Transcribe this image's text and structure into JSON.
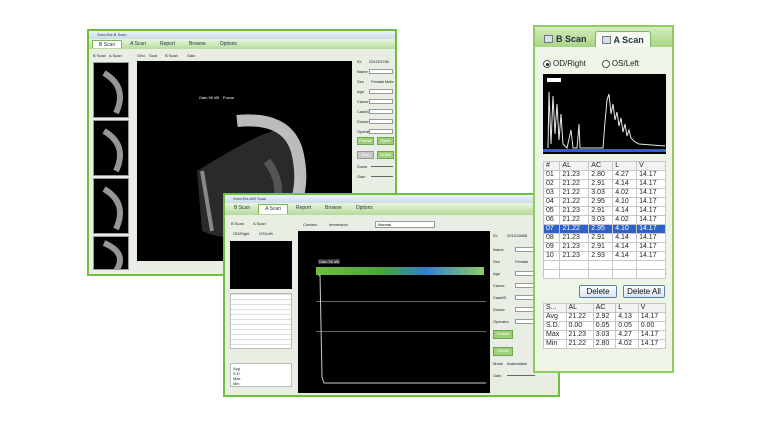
{
  "back_window": {
    "title": "SonoTek B Scan",
    "tabs": [
      "B Scan",
      "A Scan",
      "Report",
      "Browse",
      "Options"
    ],
    "subtabs": [
      "B Scan",
      "A Scan"
    ],
    "toolbar": [
      "Grid",
      "Scal",
      "B Scan",
      "Gain"
    ],
    "overlay_left": "Gain 90 dB",
    "overlay_right": "Focus",
    "id_label": "ID:",
    "id_value": "291203780",
    "form_labels": [
      "Name",
      "Sex",
      "Age",
      "Cause",
      "CaseID",
      "Doctor",
      "Operator"
    ],
    "sex_options": [
      "Female",
      "Male"
    ],
    "buttons": [
      "Freeze",
      "Save",
      "Stop",
      "Delete"
    ],
    "sliders": [
      "Zoom",
      "Gain",
      "Save"
    ]
  },
  "front_window": {
    "title": "SonoTek A/B Scan",
    "tabs": [
      "B Scan",
      "A Scan",
      "Report",
      "Browse",
      "Options"
    ],
    "subtabs": [
      "B Scan",
      "A Scan"
    ],
    "mode_radios": [
      "Contact",
      "Immersion"
    ],
    "mode_select": "Normal",
    "eye_radios": [
      "OD/Right",
      "OS/Left"
    ],
    "gain_overlay": "Gain 90 dB",
    "id_label": "ID:",
    "id_value": "291210868",
    "form_labels": [
      "Name",
      "Sex",
      "Age",
      "Cause",
      "CaseID",
      "Doctor",
      "Operator"
    ],
    "sex_value": "Female",
    "mode_label": "Mode",
    "mode_value": "Automation",
    "gain_label": "Gain",
    "stat_rows": [
      "Avg",
      "S.D.",
      "Max",
      "Min"
    ],
    "buttons": [
      "Freeze",
      "Delete"
    ]
  },
  "panel": {
    "tabs": [
      {
        "label": "B Scan",
        "icon": "bscan-icon"
      },
      {
        "label": "A Scan",
        "icon": "ascan-icon"
      }
    ],
    "eye_options": [
      {
        "label": "OD/Right",
        "selected": true
      },
      {
        "label": "OS/Left",
        "selected": false
      }
    ],
    "measure_headers": [
      "#",
      "AL",
      "AC",
      "L",
      "V"
    ],
    "measurements": [
      [
        "01",
        "21.23",
        "2.80",
        "4.27",
        "14.17"
      ],
      [
        "02",
        "21.22",
        "2.91",
        "4.14",
        "14.17"
      ],
      [
        "03",
        "21.22",
        "3.03",
        "4.02",
        "14.17"
      ],
      [
        "04",
        "21.22",
        "2.95",
        "4.10",
        "14.17"
      ],
      [
        "05",
        "21.23",
        "2.91",
        "4.14",
        "14.17"
      ],
      [
        "06",
        "21.22",
        "3.03",
        "4.02",
        "14.17"
      ],
      [
        "07",
        "21.22",
        "2.95",
        "4.10",
        "14.17"
      ],
      [
        "08",
        "21.23",
        "2.91",
        "4.14",
        "14.17"
      ],
      [
        "09",
        "21.23",
        "2.91",
        "4.14",
        "14.17"
      ],
      [
        "10",
        "21.23",
        "2.93",
        "4.14",
        "14.17"
      ]
    ],
    "selected_row": 6,
    "delete_label": "Delete",
    "delete_all_label": "Delete All",
    "stats_headers": [
      "S...",
      "AL",
      "AC",
      "L",
      "V"
    ],
    "stats": [
      [
        "Avg",
        "21.22",
        "2.92",
        "4.13",
        "14.17"
      ],
      [
        "S.D.",
        "0.00",
        "0.05",
        "0.05",
        "0.00"
      ],
      [
        "Max",
        "21.23",
        "3.03",
        "4.27",
        "14.17"
      ],
      [
        "Min",
        "21.22",
        "2.80",
        "4.02",
        "14.17"
      ]
    ],
    "accent": "#8fcb63",
    "selection_color": "#2f62c8"
  }
}
